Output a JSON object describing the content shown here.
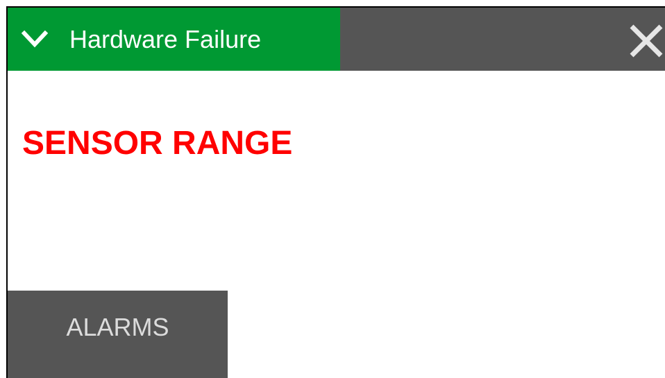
{
  "dialog": {
    "title": "Hardware Failure",
    "message": "SENSOR RANGE",
    "colors": {
      "title_tab": "#009933",
      "title_bar": "#555555",
      "message": "#ff0000",
      "button_bg": "#555555",
      "button_text": "#dcdcdc"
    },
    "icons": {
      "collapse": "chevron-down-icon",
      "close": "close-icon"
    }
  },
  "footer": {
    "alarms_label": "ALARMS"
  }
}
